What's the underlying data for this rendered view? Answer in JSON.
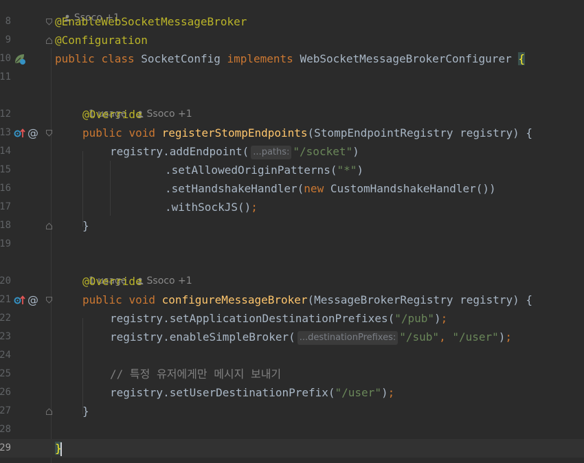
{
  "editor": {
    "file_class": "SocketConfig",
    "lens": {
      "top": {
        "author": "Ssoco +1"
      },
      "register": {
        "usages": "1 usage",
        "author": "Ssoco +1"
      },
      "configure": {
        "usages": "1 usage",
        "author": "Ssoco +1"
      }
    },
    "line_numbers": [
      "8",
      "9",
      "10",
      "11",
      "12",
      "13",
      "14",
      "15",
      "16",
      "17",
      "18",
      "19",
      "20",
      "21",
      "22",
      "23",
      "24",
      "25",
      "26",
      "27",
      "28",
      "29"
    ],
    "current_line": "29",
    "code": {
      "l8_annotation": "@EnableWebSocketMessageBroker",
      "l9_annotation": "@Configuration",
      "l10_public": "public",
      "l10_class": "class",
      "l10_name": "SocketConfig",
      "l10_implements": "implements",
      "l10_iface": "WebSocketMessageBrokerConfigurer",
      "l10_brace": "{",
      "l12_override": "@Override",
      "l13_public": "public",
      "l13_void": "void",
      "l13_method": "registerStompEndpoints",
      "l13_params": "(StompEndpointRegistry registry) {",
      "l14_call": "registry.addEndpoint(",
      "l14_hint": "...paths:",
      "l14_str": "\"/socket\"",
      "l14_close": ")",
      "l15_call": ".setAllowedOriginPatterns(",
      "l15_str": "\"*\"",
      "l15_close": ")",
      "l16_call": ".setHandshakeHandler(",
      "l16_new": "new",
      "l16_rest": "CustomHandshakeHandler())",
      "l17_call": ".withSockJS()",
      "l17_semi": ";",
      "l18_brace": "}",
      "l20_override": "@Override",
      "l21_public": "public",
      "l21_void": "void",
      "l21_method": "configureMessageBroker",
      "l21_params": "(MessageBrokerRegistry registry) {",
      "l22_call": "registry.setApplicationDestinationPrefixes(",
      "l22_str": "\"/pub\"",
      "l22_close": ")",
      "l22_semi": ";",
      "l23_call": "registry.enableSimpleBroker(",
      "l23_hint": "...destinationPrefixes:",
      "l23_str1": "\"/sub\"",
      "l23_comma": ",",
      "l23_str2": "\"/user\"",
      "l23_close": ")",
      "l23_semi": ";",
      "l25_comment": "// 특정 유저에게만 메시지 보내기",
      "l26_call": "registry.setUserDestinationPrefix(",
      "l26_str": "\"/user\"",
      "l26_close": ")",
      "l26_semi": ";",
      "l27_brace": "}",
      "l29_brace": "}"
    },
    "gutter_at": "@"
  },
  "colors": {
    "background": "#2b2b2b",
    "keyword": "#cc7832",
    "annotation": "#bbb529",
    "method": "#ffc66d",
    "string": "#6a8759",
    "comment": "#808080",
    "text": "#a9b7c6"
  }
}
